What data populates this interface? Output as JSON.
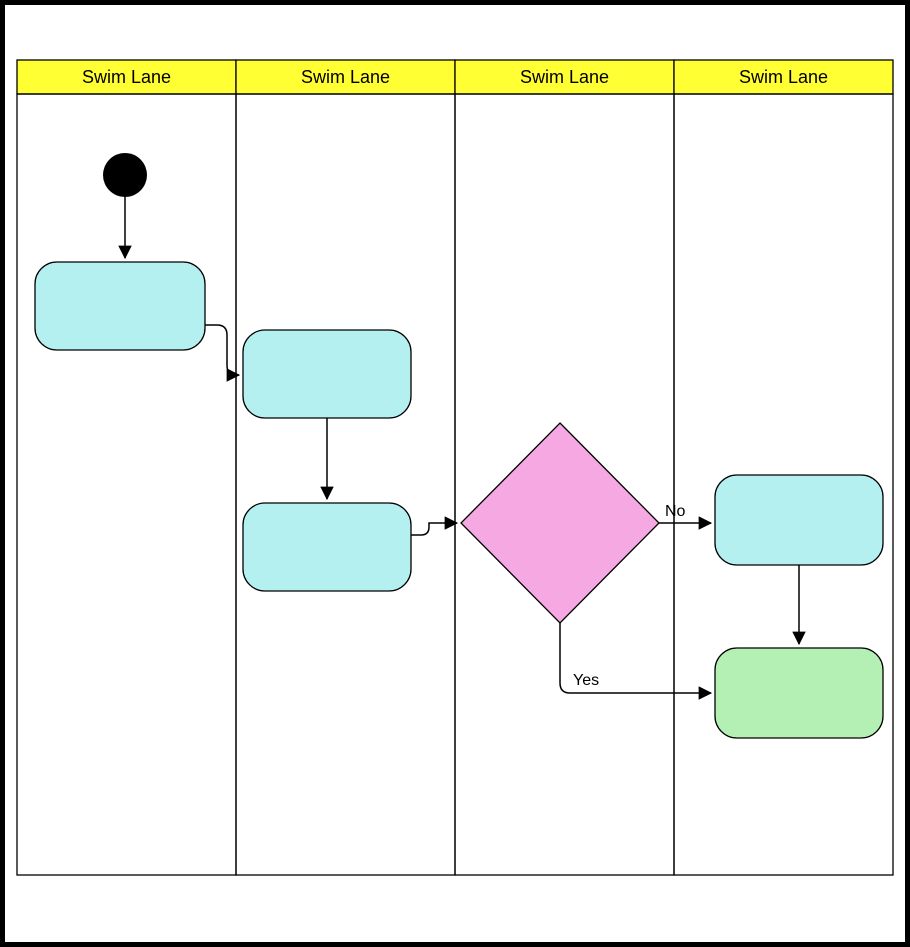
{
  "diagram": {
    "type": "swimlane-flowchart",
    "lanes": [
      {
        "label": "Swim Lane"
      },
      {
        "label": "Swim Lane"
      },
      {
        "label": "Swim Lane"
      },
      {
        "label": "Swim Lane"
      }
    ],
    "nodes": {
      "start": {
        "kind": "start",
        "lane": 0
      },
      "task1": {
        "kind": "task",
        "lane": 0,
        "label": ""
      },
      "task2": {
        "kind": "task",
        "lane": 1,
        "label": ""
      },
      "task3": {
        "kind": "task",
        "lane": 1,
        "label": ""
      },
      "decision": {
        "kind": "decision",
        "lane": 2,
        "label": ""
      },
      "task4": {
        "kind": "task",
        "lane": 3,
        "label": ""
      },
      "task5": {
        "kind": "end-task",
        "lane": 3,
        "label": ""
      }
    },
    "edges": [
      {
        "from": "start",
        "to": "task1",
        "label": ""
      },
      {
        "from": "task1",
        "to": "task2",
        "label": ""
      },
      {
        "from": "task2",
        "to": "task3",
        "label": ""
      },
      {
        "from": "task3",
        "to": "decision",
        "label": ""
      },
      {
        "from": "decision",
        "to": "task4",
        "label": "No"
      },
      {
        "from": "decision",
        "to": "task5",
        "label": "Yes"
      },
      {
        "from": "task4",
        "to": "task5",
        "label": ""
      }
    ]
  }
}
